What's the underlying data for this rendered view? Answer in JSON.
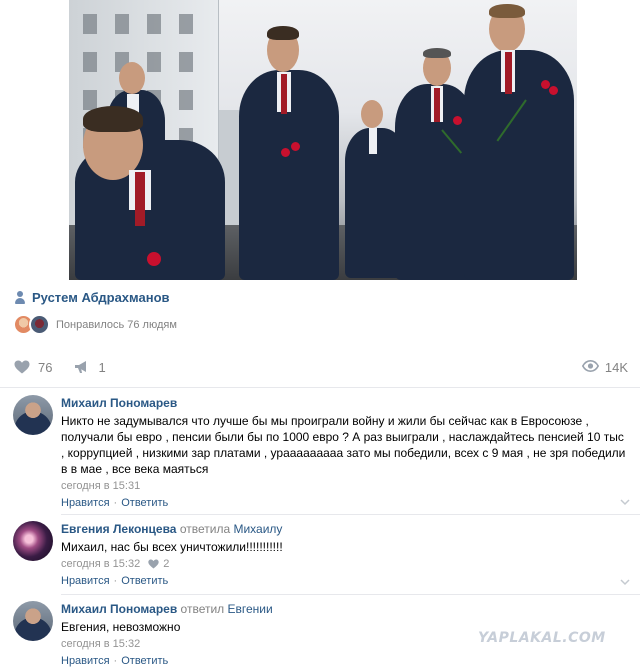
{
  "post": {
    "author": "Рустем Абдрахманов",
    "liked_text": "Понравилось 76 людям",
    "likes_count": "76",
    "reposts_count": "1",
    "views_count": "14K"
  },
  "icons": {
    "author": "person-icon",
    "likes": "heart-icon",
    "reposts": "megaphone-icon",
    "views": "eye-icon",
    "comment_likes": "heart-icon",
    "collapse": "chevron-down-icon"
  },
  "colors": {
    "link": "#2a5885",
    "meta": "#828282",
    "divider": "#e7e8ec"
  },
  "comments": [
    {
      "author": "Михаил Пономарев",
      "reply_word": "",
      "reply_to": "",
      "text": "Никто не задумывался что лучше бы мы проиграли войну и жили бы сейчас как в Евросоюзе , получали бы евро , пенсии были бы по 1000 евро ? А раз выиграли , наслаждайтесь пенсией 10 тыс , коррупцией , низкими зар платами , урааааааааа зато мы победили, всех с 9 мая , не зря победили в в мае , все века маяться",
      "time": "сегодня в 15:31",
      "likes": "",
      "like_action": "Нравится",
      "reply_action": "Ответить"
    },
    {
      "author": "Евгения Леконцева",
      "reply_word": "ответила",
      "reply_to": "Михаилу",
      "text": "Михаил, нас бы всех уничтожили!!!!!!!!!!!",
      "time": "сегодня в 15:32",
      "likes": "2",
      "like_action": "Нравится",
      "reply_action": "Ответить"
    },
    {
      "author": "Михаил Пономарев",
      "reply_word": "ответил",
      "reply_to": "Евгении",
      "text": "Евгения, невозможно",
      "time": "сегодня в 15:32",
      "likes": "",
      "like_action": "Нравится",
      "reply_action": "Ответить"
    }
  ],
  "watermark": "YAPLAKAL.COM"
}
